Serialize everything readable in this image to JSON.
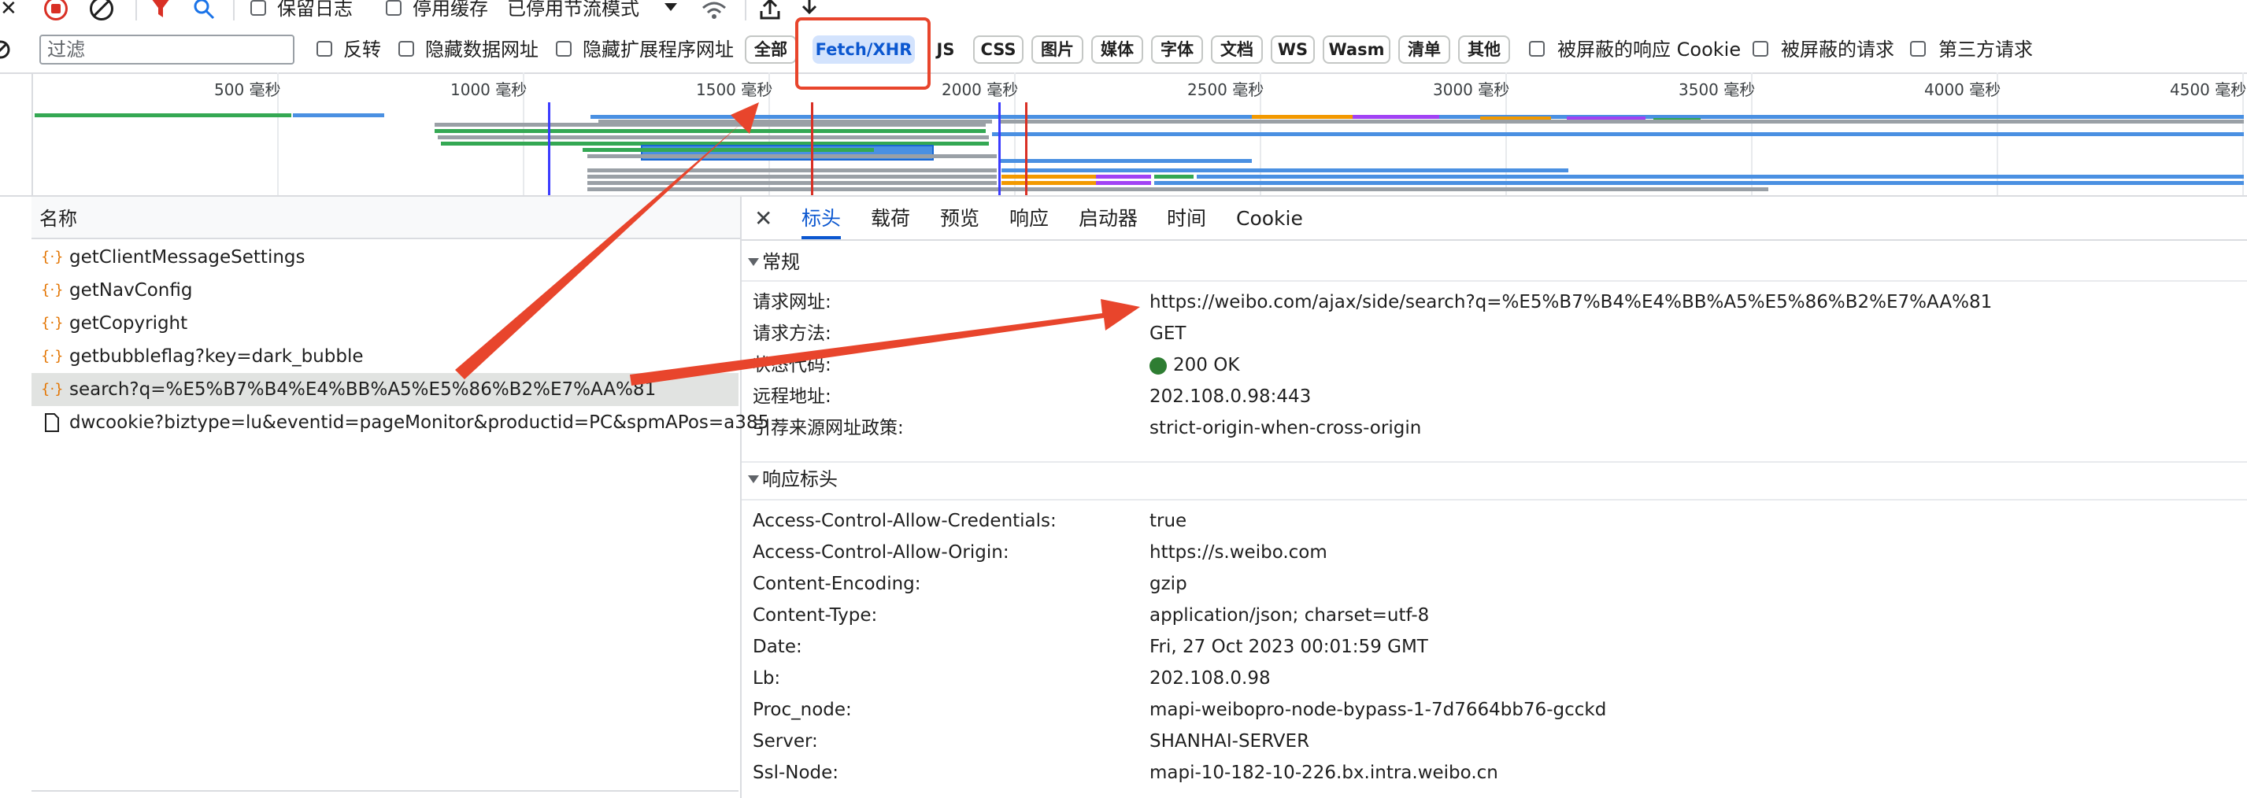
{
  "toolbar1": {
    "close_glyph": "✕",
    "preserve_log": "保留日志",
    "disable_cache": "停用缓存",
    "throttle": "已停用节流模式"
  },
  "filter_bar": {
    "placeholder": "过滤",
    "invert": "反转",
    "hide_data_urls": "隐藏数据网址",
    "hide_ext_urls": "隐藏扩展程序网址",
    "types": [
      "全部",
      "Fetch/XHR",
      "JS",
      "CSS",
      "图片",
      "媒体",
      "字体",
      "文档",
      "WS",
      "Wasm",
      "清单",
      "其他"
    ],
    "active_type": "Fetch/XHR",
    "blocked_cookies": "被屏蔽的响应 Cookie",
    "blocked_requests": "被屏蔽的请求",
    "third_party": "第三方请求"
  },
  "timeline": {
    "ticks": [
      "500 毫秒",
      "1000 毫秒",
      "1500 毫秒",
      "2000 毫秒",
      "2500 毫秒",
      "3000 毫秒",
      "3500 毫秒",
      "4000 毫秒",
      "4500 毫秒"
    ]
  },
  "request_list": {
    "header": "名称",
    "items": [
      {
        "name": "getClientMessageSettings",
        "type": "xhr"
      },
      {
        "name": "getNavConfig",
        "type": "xhr"
      },
      {
        "name": "getCopyright",
        "type": "xhr"
      },
      {
        "name": "getbubbleflag?key=dark_bubble",
        "type": "xhr"
      },
      {
        "name": "search?q=%E5%B7%B4%E4%BB%A5%E5%86%B2%E7%AA%81",
        "type": "xhr",
        "selected": true
      },
      {
        "name": "dwcookie?biztype=lu&eventid=pageMonitor&productid=PC&spmAPos=a385",
        "type": "doc"
      }
    ]
  },
  "detail": {
    "close_glyph": "✕",
    "tabs": [
      "标头",
      "载荷",
      "预览",
      "响应",
      "启动器",
      "时间",
      "Cookie"
    ],
    "active_tab": "标头",
    "general_title": "常规",
    "general": [
      {
        "k": "请求网址:",
        "v": "https://weibo.com/ajax/side/search?q=%E5%B7%B4%E4%BB%A5%E5%86%B2%E7%AA%81"
      },
      {
        "k": "请求方法:",
        "v": "GET"
      },
      {
        "k": "状态代码:",
        "v": "200 OK"
      },
      {
        "k": "远程地址:",
        "v": "202.108.0.98:443"
      },
      {
        "k": "引荐来源网址政策:",
        "v": "strict-origin-when-cross-origin"
      }
    ],
    "response_title": "响应标头",
    "response_headers": [
      {
        "k": "Access-Control-Allow-Credentials:",
        "v": "true"
      },
      {
        "k": "Access-Control-Allow-Origin:",
        "v": "https://s.weibo.com"
      },
      {
        "k": "Content-Encoding:",
        "v": "gzip"
      },
      {
        "k": "Content-Type:",
        "v": "application/json; charset=utf-8"
      },
      {
        "k": "Date:",
        "v": "Fri, 27 Oct 2023 00:01:59 GMT"
      },
      {
        "k": "Lb:",
        "v": "202.108.0.98"
      },
      {
        "k": "Proc_node:",
        "v": "mapi-weibopro-node-bypass-1-7d7664bb76-gcckd"
      },
      {
        "k": "Server:",
        "v": "SHANHAI-SERVER"
      },
      {
        "k": "Ssl-Node:",
        "v": "mapi-10-182-10-226.bx.intra.weibo.cn"
      }
    ]
  },
  "colors": {
    "accent": "#0b57d0",
    "annotation_red": "#e8452c",
    "status_green": "#2e7d32"
  }
}
